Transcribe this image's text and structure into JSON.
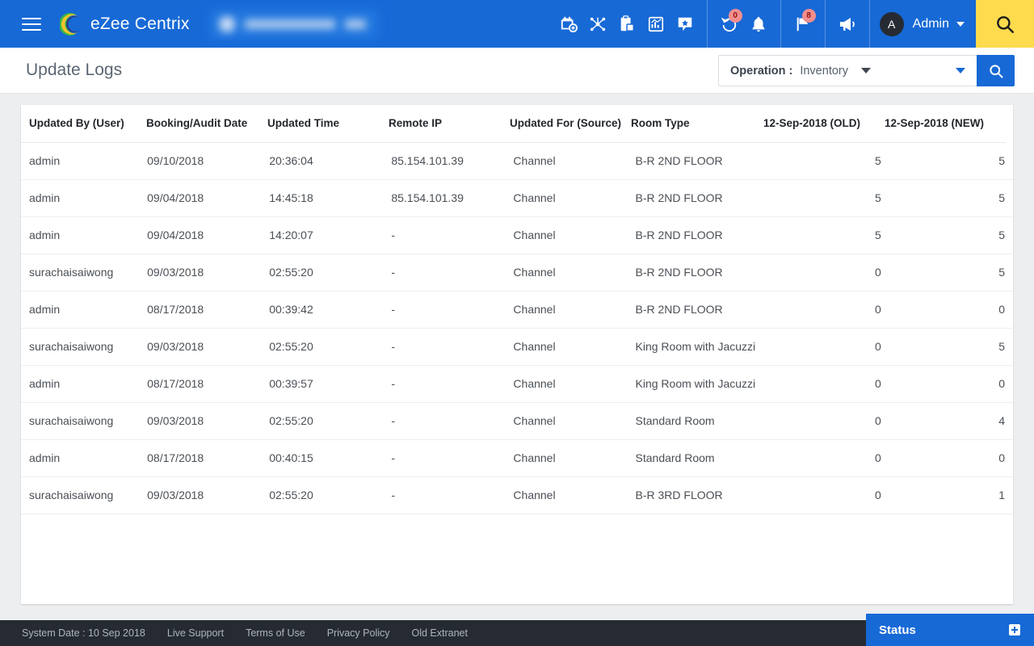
{
  "topbar": {
    "brand": "eZee Centrix",
    "menu_icon": "hamburger-menu-icon",
    "property_selector_redacted": "",
    "icons": [
      {
        "name": "calendar-add-icon",
        "badge": null
      },
      {
        "name": "network-share-icon",
        "badge": null
      },
      {
        "name": "clipboard-icon",
        "badge": null
      },
      {
        "name": "chart-report-icon",
        "badge": null
      },
      {
        "name": "star-message-icon",
        "badge": null
      }
    ],
    "icons2": [
      {
        "name": "history-restore-icon",
        "badge": "0"
      },
      {
        "name": "bell-icon",
        "badge": null
      }
    ],
    "icons3": [
      {
        "name": "flag-icon",
        "badge": "8"
      }
    ],
    "icons4": [
      {
        "name": "megaphone-icon",
        "badge": null
      }
    ],
    "user": {
      "initial": "A",
      "name": "Admin"
    },
    "search_icon": "search-icon"
  },
  "page": {
    "title": "Update Logs"
  },
  "filter": {
    "operation_label": "Operation :",
    "operation_value": "Inventory",
    "search_button_icon": "search-icon"
  },
  "table": {
    "columns": [
      "Updated By (User)",
      "Booking/Audit Date",
      "Updated Time",
      "Remote IP",
      "Updated For (Source)",
      "Room Type",
      "12-Sep-2018 (OLD)",
      "12-Sep-2018 (NEW)"
    ],
    "rows": [
      {
        "user": "admin",
        "date": "09/10/2018",
        "time": "20:36:04",
        "ip": "85.154.101.39",
        "source": "Channel",
        "room": "B-R 2ND FLOOR",
        "old": "5",
        "new": "5"
      },
      {
        "user": "admin",
        "date": "09/04/2018",
        "time": "14:45:18",
        "ip": "85.154.101.39",
        "source": "Channel",
        "room": "B-R 2ND FLOOR",
        "old": "5",
        "new": "5"
      },
      {
        "user": "admin",
        "date": "09/04/2018",
        "time": "14:20:07",
        "ip": "-",
        "source": "Channel",
        "room": "B-R 2ND FLOOR",
        "old": "5",
        "new": "5"
      },
      {
        "user": "surachaisaiwong",
        "date": "09/03/2018",
        "time": "02:55:20",
        "ip": "-",
        "source": "Channel",
        "room": "B-R 2ND FLOOR",
        "old": "0",
        "new": "5"
      },
      {
        "user": "admin",
        "date": "08/17/2018",
        "time": "00:39:42",
        "ip": "-",
        "source": "Channel",
        "room": "B-R 2ND FLOOR",
        "old": "0",
        "new": "0"
      },
      {
        "user": "surachaisaiwong",
        "date": "09/03/2018",
        "time": "02:55:20",
        "ip": "-",
        "source": "Channel",
        "room": "King Room with Jacuzzi",
        "old": "0",
        "new": "5"
      },
      {
        "user": "admin",
        "date": "08/17/2018",
        "time": "00:39:57",
        "ip": "-",
        "source": "Channel",
        "room": "King Room with Jacuzzi",
        "old": "0",
        "new": "0"
      },
      {
        "user": "surachaisaiwong",
        "date": "09/03/2018",
        "time": "02:55:20",
        "ip": "-",
        "source": "Channel",
        "room": "Standard Room",
        "old": "0",
        "new": "4"
      },
      {
        "user": "admin",
        "date": "08/17/2018",
        "time": "00:40:15",
        "ip": "-",
        "source": "Channel",
        "room": "Standard Room",
        "old": "0",
        "new": "0"
      },
      {
        "user": "surachaisaiwong",
        "date": "09/03/2018",
        "time": "02:55:20",
        "ip": "-",
        "source": "Channel",
        "room": "B-R 3RD FLOOR",
        "old": "0",
        "new": "1"
      }
    ]
  },
  "footer": {
    "links": [
      "System Date : 10 Sep 2018",
      "Live Support",
      "Terms of Use",
      "Privacy Policy",
      "Old Extranet"
    ],
    "status_label": "Status",
    "status_icon": "plus-box-icon"
  },
  "colors": {
    "primary": "#1769d6",
    "accent_yellow": "#fedb4d",
    "footer_dark": "#262b33",
    "badge_red": "#f38e8e",
    "content_bg": "#eceef0"
  }
}
